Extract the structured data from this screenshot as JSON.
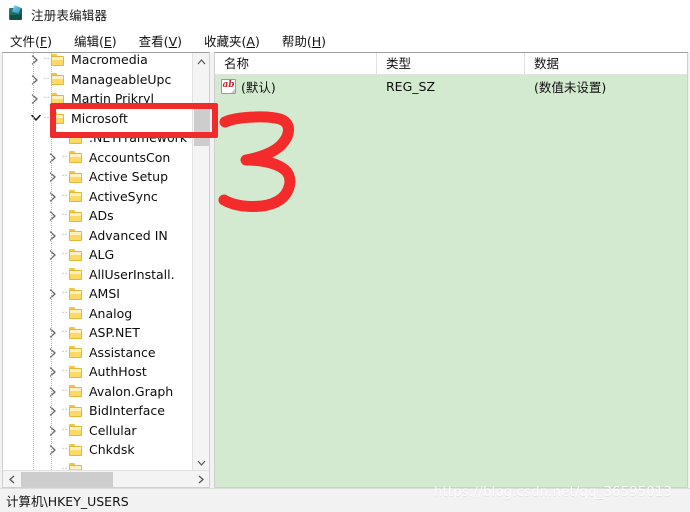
{
  "window": {
    "title": "注册表编辑器",
    "icon": "registry-editor-icon"
  },
  "menubar": {
    "items": [
      {
        "label": "文件(F)",
        "text": "文件(",
        "accel": "F",
        "tail": ")"
      },
      {
        "label": "编辑(E)",
        "text": "编辑(",
        "accel": "E",
        "tail": ")"
      },
      {
        "label": "查看(V)",
        "text": "查看(",
        "accel": "V",
        "tail": ")"
      },
      {
        "label": "收藏夹(A)",
        "text": "收藏夹(",
        "accel": "A",
        "tail": ")"
      },
      {
        "label": "帮助(H)",
        "text": "帮助(",
        "accel": "H",
        "tail": ")"
      }
    ]
  },
  "tree": {
    "items": [
      {
        "label": "Macromedia",
        "level": 1,
        "expander": "collapsed"
      },
      {
        "label": "ManageableUpc",
        "level": 1,
        "expander": "collapsed"
      },
      {
        "label": "Martin Prikryl",
        "level": 1,
        "expander": "collapsed"
      },
      {
        "label": "Microsoft",
        "level": 1,
        "expander": "expanded",
        "selected": true
      },
      {
        "label": ".NETFramework",
        "level": 2,
        "expander": "none"
      },
      {
        "label": "AccountsCon",
        "level": 2,
        "expander": "collapsed"
      },
      {
        "label": "Active Setup",
        "level": 2,
        "expander": "collapsed"
      },
      {
        "label": "ActiveSync",
        "level": 2,
        "expander": "collapsed"
      },
      {
        "label": "ADs",
        "level": 2,
        "expander": "collapsed"
      },
      {
        "label": "Advanced IN",
        "level": 2,
        "expander": "collapsed"
      },
      {
        "label": "ALG",
        "level": 2,
        "expander": "collapsed"
      },
      {
        "label": "AllUserInstall.",
        "level": 2,
        "expander": "none"
      },
      {
        "label": "AMSI",
        "level": 2,
        "expander": "collapsed"
      },
      {
        "label": "Analog",
        "level": 2,
        "expander": "none"
      },
      {
        "label": "ASP.NET",
        "level": 2,
        "expander": "collapsed"
      },
      {
        "label": "Assistance",
        "level": 2,
        "expander": "collapsed"
      },
      {
        "label": "AuthHost",
        "level": 2,
        "expander": "collapsed"
      },
      {
        "label": "Avalon.Graph",
        "level": 2,
        "expander": "collapsed"
      },
      {
        "label": "BidInterface",
        "level": 2,
        "expander": "collapsed"
      },
      {
        "label": "Cellular",
        "level": 2,
        "expander": "collapsed"
      },
      {
        "label": "Chkdsk",
        "level": 2,
        "expander": "collapsed"
      },
      {
        "label": "",
        "level": 2,
        "expander": "none"
      }
    ]
  },
  "list": {
    "columns": [
      {
        "label": "名称"
      },
      {
        "label": "类型"
      },
      {
        "label": "数据"
      }
    ],
    "rows": [
      {
        "icon": "string-value-icon",
        "name": "(默认)",
        "type": "REG_SZ",
        "data": "(数值未设置)"
      }
    ]
  },
  "statusbar": {
    "path": "计算机\\HKEY_USERS"
  },
  "watermark": {
    "text": "https://blog.csdn.net/qq_36595013"
  },
  "annotations": {
    "highlight_target": "Microsoft",
    "step_number": "3"
  },
  "colors": {
    "list_background": "#d3ead0",
    "annotation_red": "#ef2b2b",
    "folder_yellow": "#ffd966",
    "scrollbar_thumb": "#cdcdcd"
  }
}
